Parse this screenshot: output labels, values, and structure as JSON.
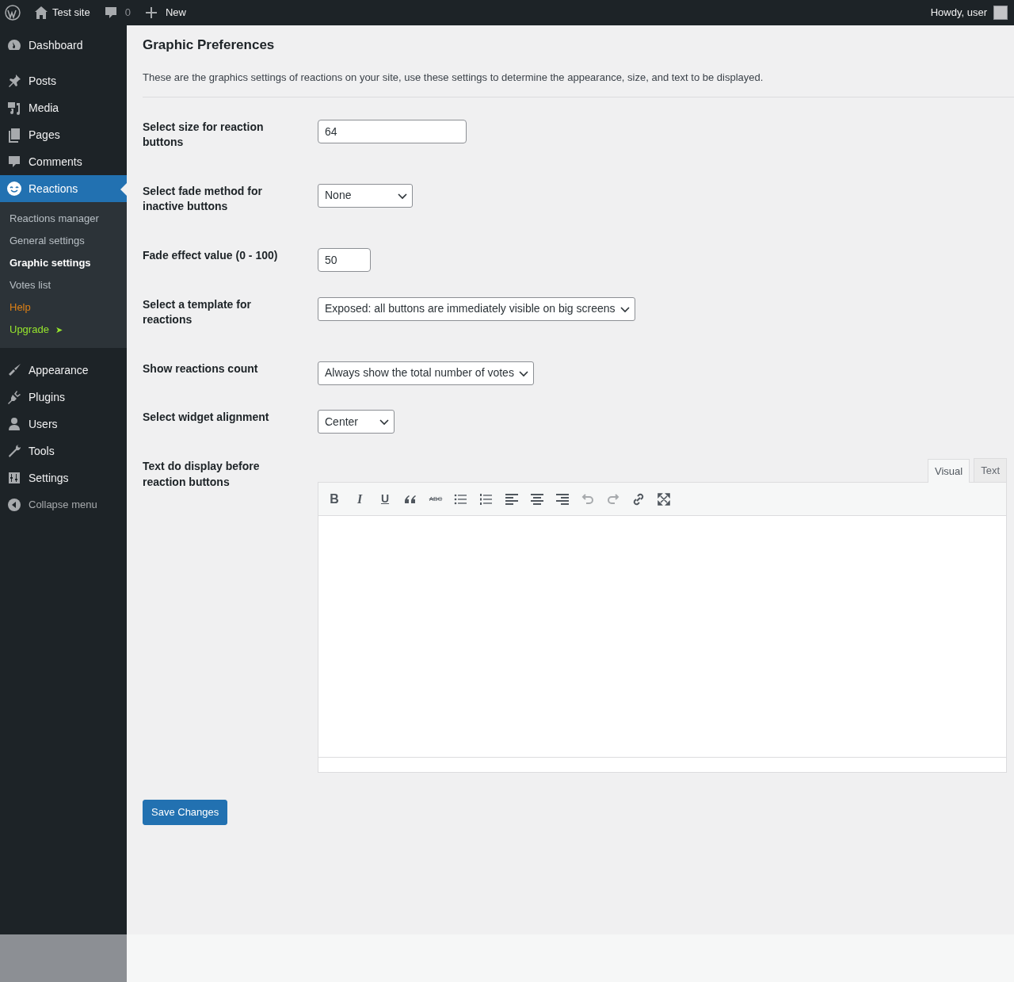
{
  "admin_bar": {
    "site": "Test site",
    "comments": "0",
    "new": "New",
    "greeting": "Howdy, user"
  },
  "menu": [
    {
      "label": "Dashboard",
      "selected": false
    },
    {
      "label": "Posts",
      "selected": false
    },
    {
      "label": "Media",
      "selected": false
    },
    {
      "label": "Pages",
      "selected": false
    },
    {
      "label": "Comments",
      "selected": false
    },
    {
      "label": "Reactions",
      "selected": true,
      "children": [
        {
          "label": "Reactions manager",
          "kind": "normal",
          "selected": false
        },
        {
          "label": "General settings",
          "kind": "normal",
          "selected": false
        },
        {
          "label": "Graphic settings",
          "kind": "normal",
          "selected": true
        },
        {
          "label": "Votes list",
          "kind": "normal",
          "selected": false
        },
        {
          "label": "Help",
          "kind": "help",
          "selected": false
        },
        {
          "label": "Upgrade",
          "kind": "upgrade",
          "selected": false,
          "arrow": "➤"
        }
      ]
    },
    {
      "label": "Appearance",
      "selected": false
    },
    {
      "label": "Plugins",
      "selected": false
    },
    {
      "label": "Users",
      "selected": false
    },
    {
      "label": "Tools",
      "selected": false
    },
    {
      "label": "Settings",
      "selected": false
    }
  ],
  "collapse": "Collapse menu",
  "page": {
    "title": "Graphic Preferences",
    "description": "These are the graphics settings of reactions on your site, use these settings to determine the appearance, size, and text to be displayed.",
    "fields": [
      {
        "label": "Select size for reaction buttons",
        "kind": "text",
        "value": "64"
      },
      {
        "label": "Select fade method for inactive buttons",
        "kind": "select",
        "value": "None"
      },
      {
        "label": "Fade effect value (0 - 100)",
        "kind": "number",
        "value": "50"
      },
      {
        "label": "Select a template for reactions",
        "kind": "select",
        "value": "Exposed: all buttons are immediately visible on big screens"
      },
      {
        "label": "Show reactions count",
        "kind": "select",
        "value": "Always show the total number of votes"
      },
      {
        "label": "Select widget alignment",
        "kind": "select",
        "value": "Center"
      },
      {
        "label": "Text do display before reaction buttons",
        "kind": "editor"
      }
    ],
    "editor": {
      "tabs": [
        {
          "label": "Visual",
          "selected": true
        },
        {
          "label": "Text",
          "selected": false
        }
      ],
      "toolbar": [
        {
          "kind": "bold",
          "label": "B",
          "disabled": false
        },
        {
          "kind": "italic",
          "label": "I",
          "disabled": false
        },
        {
          "kind": "underline",
          "label": "U",
          "disabled": false
        },
        {
          "kind": "quote",
          "disabled": false
        },
        {
          "kind": "strike",
          "label": "ABC",
          "disabled": false
        },
        {
          "kind": "bullets",
          "disabled": false
        },
        {
          "kind": "numbers",
          "disabled": false
        },
        {
          "kind": "left",
          "disabled": false
        },
        {
          "kind": "center",
          "disabled": false
        },
        {
          "kind": "right",
          "disabled": false
        },
        {
          "kind": "undo",
          "disabled": true
        },
        {
          "kind": "redo",
          "disabled": true
        },
        {
          "kind": "link",
          "disabled": false
        },
        {
          "kind": "fullscreen",
          "disabled": false
        }
      ]
    },
    "save": "Save Changes"
  }
}
